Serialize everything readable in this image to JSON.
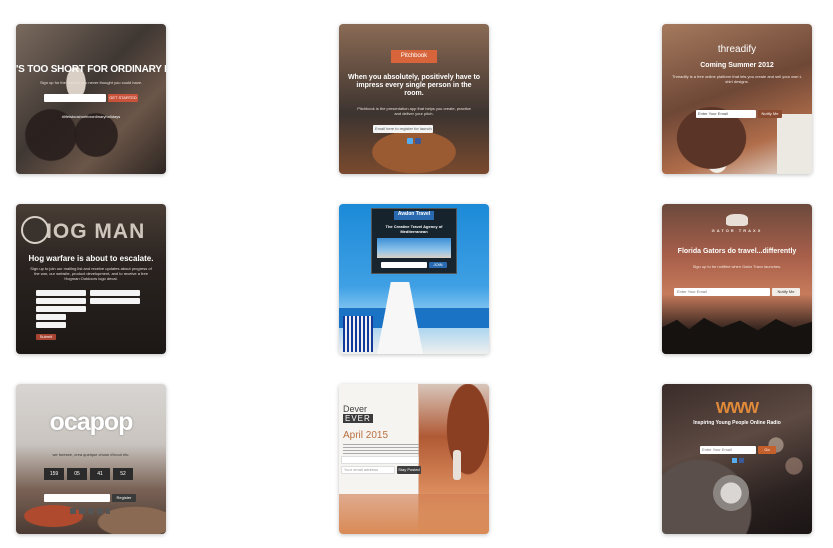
{
  "cards": [
    {
      "headline": "'S TOO SHORT FOR ORDINARY HOLIDA",
      "subline": "Sign up for the holiday you never thought you could have.",
      "button": "GET STARTED",
      "hashtag": "#lifeistooshortforordinaryholidays"
    },
    {
      "logo": "Pitchbook",
      "headline": "When you absolutely, positively have to impress every single person in the room.",
      "body": "Pitchbook is the presentation app that helps you create, practice and deliver your pitch.",
      "input_placeholder": "Email here to register for launch"
    },
    {
      "logo": "threadify",
      "headline": "Coming Summer 2012",
      "body": "Threadify is a free online platform that lets you create and sell your own t-shirt designs.",
      "input_placeholder": "Enter Your Email",
      "button": "Notify Me"
    },
    {
      "logo": "HOG MAN",
      "headline": "Hog warfare is about to escalate.",
      "body": "Sign up to join our mailing list and receive updates about progress of the war, our website, product development, and to receive a free Hogman Outdoors logo decal.",
      "button": "Submit"
    },
    {
      "logo": "Avalon Travel",
      "headline": "The Creative Travel Agency of Mediterranean",
      "button": "JOIN"
    },
    {
      "logo": "GATOR TRAXX",
      "headline": "Florida Gators do travel...differently",
      "body": "Sign up to be notified when Gator Traxx launches.",
      "input_placeholder": "Enter Your Email",
      "button": "Notify Me"
    },
    {
      "logo": "ocapop",
      "body": "we foresee, crea quelque chose d'inouï etc.",
      "countdown": [
        "159",
        "05",
        "41",
        "52"
      ],
      "button": "Register"
    },
    {
      "logo_line1": "Dever",
      "logo_line2": "EVER",
      "headline": "April 2015",
      "input_placeholder": "Your email address",
      "button": "Stay Posted"
    },
    {
      "logo": "WWW",
      "headline": "Inspiring Young People Online Radio",
      "input_placeholder": "Enter Your Email",
      "button": "Go"
    }
  ]
}
